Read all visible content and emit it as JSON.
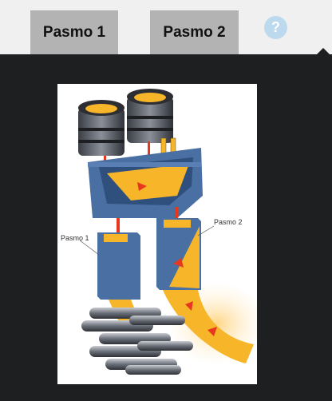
{
  "tabs": [
    {
      "label": "Pasmo 1"
    },
    {
      "label": "Pasmo 2"
    }
  ],
  "help": {
    "label": "?"
  },
  "figure": {
    "labels": {
      "strand1": "Pasmo 1",
      "strand2": "Pasmo 2"
    }
  },
  "colors": {
    "tab_bg": "#b3b3b3",
    "panel_bg": "#1e1f21",
    "help_bg": "#bcd9ee",
    "steel": "#f7b52a",
    "mold": "#4a6fa3",
    "arrow": "#e8371f"
  }
}
